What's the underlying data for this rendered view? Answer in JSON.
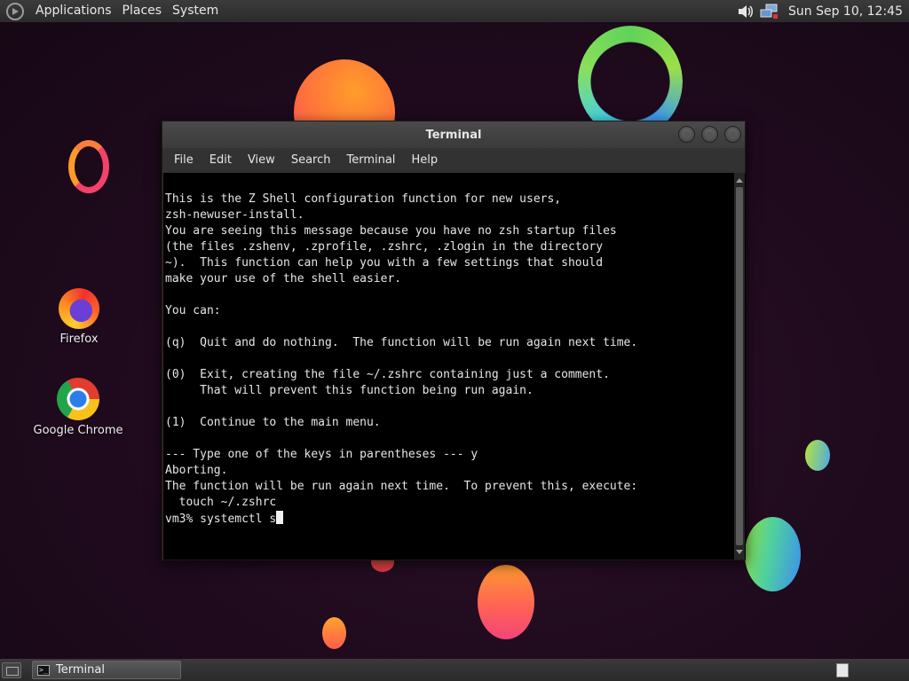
{
  "top_panel": {
    "menus": [
      "Applications",
      "Places",
      "System"
    ],
    "clock": "Sun Sep 10, 12:45",
    "tray_icons": [
      "speaker-icon",
      "network-icon"
    ]
  },
  "desktop_icons": [
    {
      "label": "Firefox",
      "icon": "firefox-icon"
    },
    {
      "label": "Google Chrome",
      "icon": "chrome-icon"
    }
  ],
  "window": {
    "title": "Terminal",
    "menu": [
      "File",
      "Edit",
      "View",
      "Search",
      "Terminal",
      "Help"
    ]
  },
  "terminal": {
    "lines": [
      "This is the Z Shell configuration function for new users,",
      "zsh-newuser-install.",
      "You are seeing this message because you have no zsh startup files",
      "(the files .zshenv, .zprofile, .zshrc, .zlogin in the directory",
      "~).  This function can help you with a few settings that should",
      "make your use of the shell easier.",
      "",
      "You can:",
      "",
      "(q)  Quit and do nothing.  The function will be run again next time.",
      "",
      "(0)  Exit, creating the file ~/.zshrc containing just a comment.",
      "     That will prevent this function being run again.",
      "",
      "(1)  Continue to the main menu.",
      "",
      "--- Type one of the keys in parentheses --- y",
      "Aborting.",
      "The function will be run again next time.  To prevent this, execute:",
      "  touch ~/.zshrc"
    ],
    "prompt_line": "vm3% systemctl s"
  },
  "taskbar": {
    "tasks": [
      {
        "label": "Terminal",
        "icon": "terminal-icon"
      }
    ]
  }
}
